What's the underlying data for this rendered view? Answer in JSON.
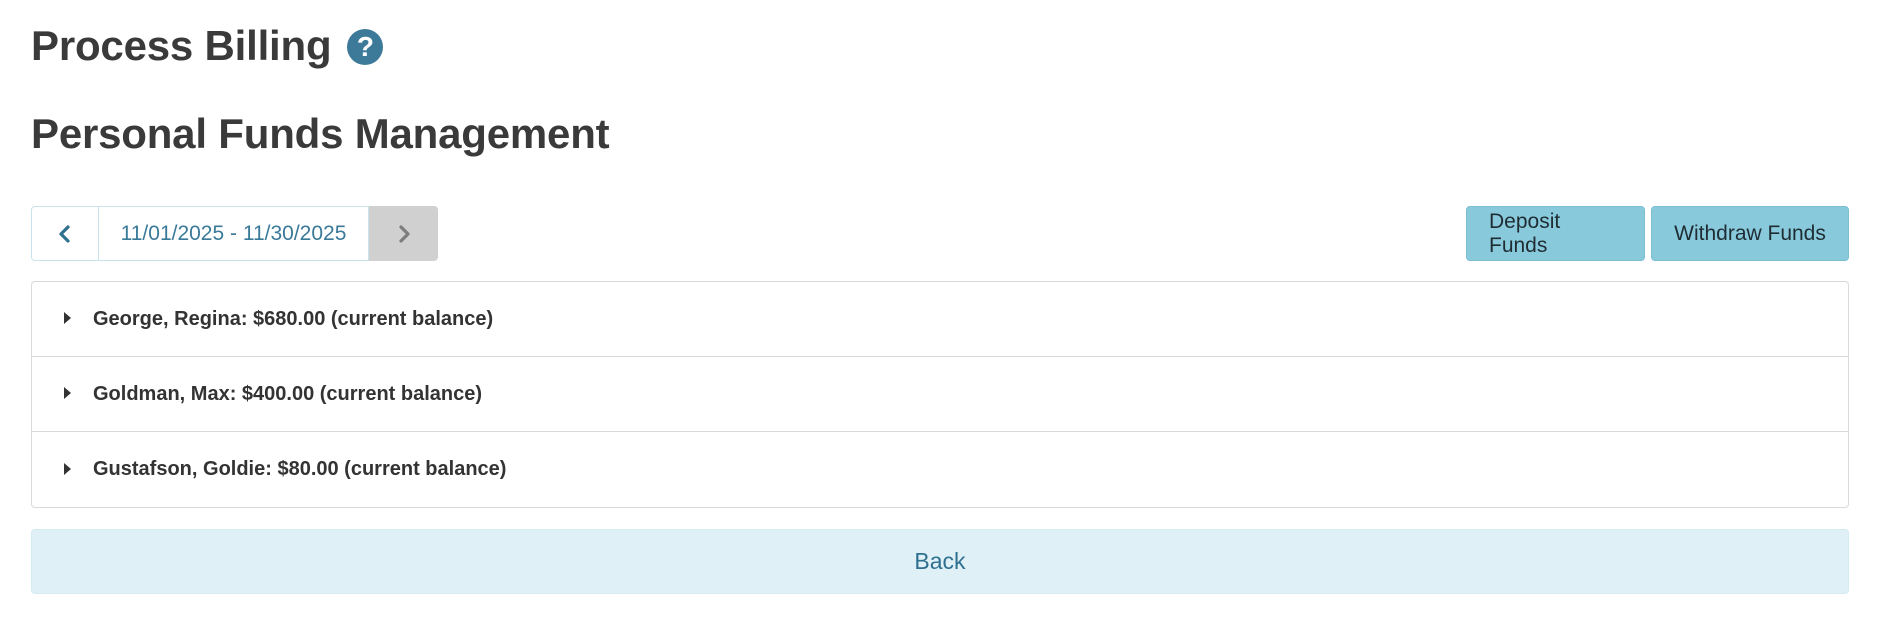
{
  "header": {
    "title": "Process Billing",
    "help_icon": "question-circle-icon",
    "help_glyph": "?"
  },
  "section": {
    "title": "Personal Funds Management"
  },
  "date_nav": {
    "prev_icon": "chevron-left-icon",
    "range": "11/01/2025 - 11/30/2025",
    "next_icon": "chevron-right-icon"
  },
  "actions": {
    "deposit_label": "Deposit Funds",
    "withdraw_label": "Withdraw Funds"
  },
  "accounts": [
    {
      "text": "George, Regina: $680.00 (current balance)"
    },
    {
      "text": "Goldman, Max: $400.00 (current balance)"
    },
    {
      "text": "Gustafson, Goldie: $80.00 (current balance)"
    }
  ],
  "footer": {
    "back_label": "Back"
  },
  "colors": {
    "accent": "#3d7a99",
    "action_button": "#88c9dc",
    "back_button_bg": "#dff1f6",
    "disabled_nav": "#d0d0d0"
  }
}
